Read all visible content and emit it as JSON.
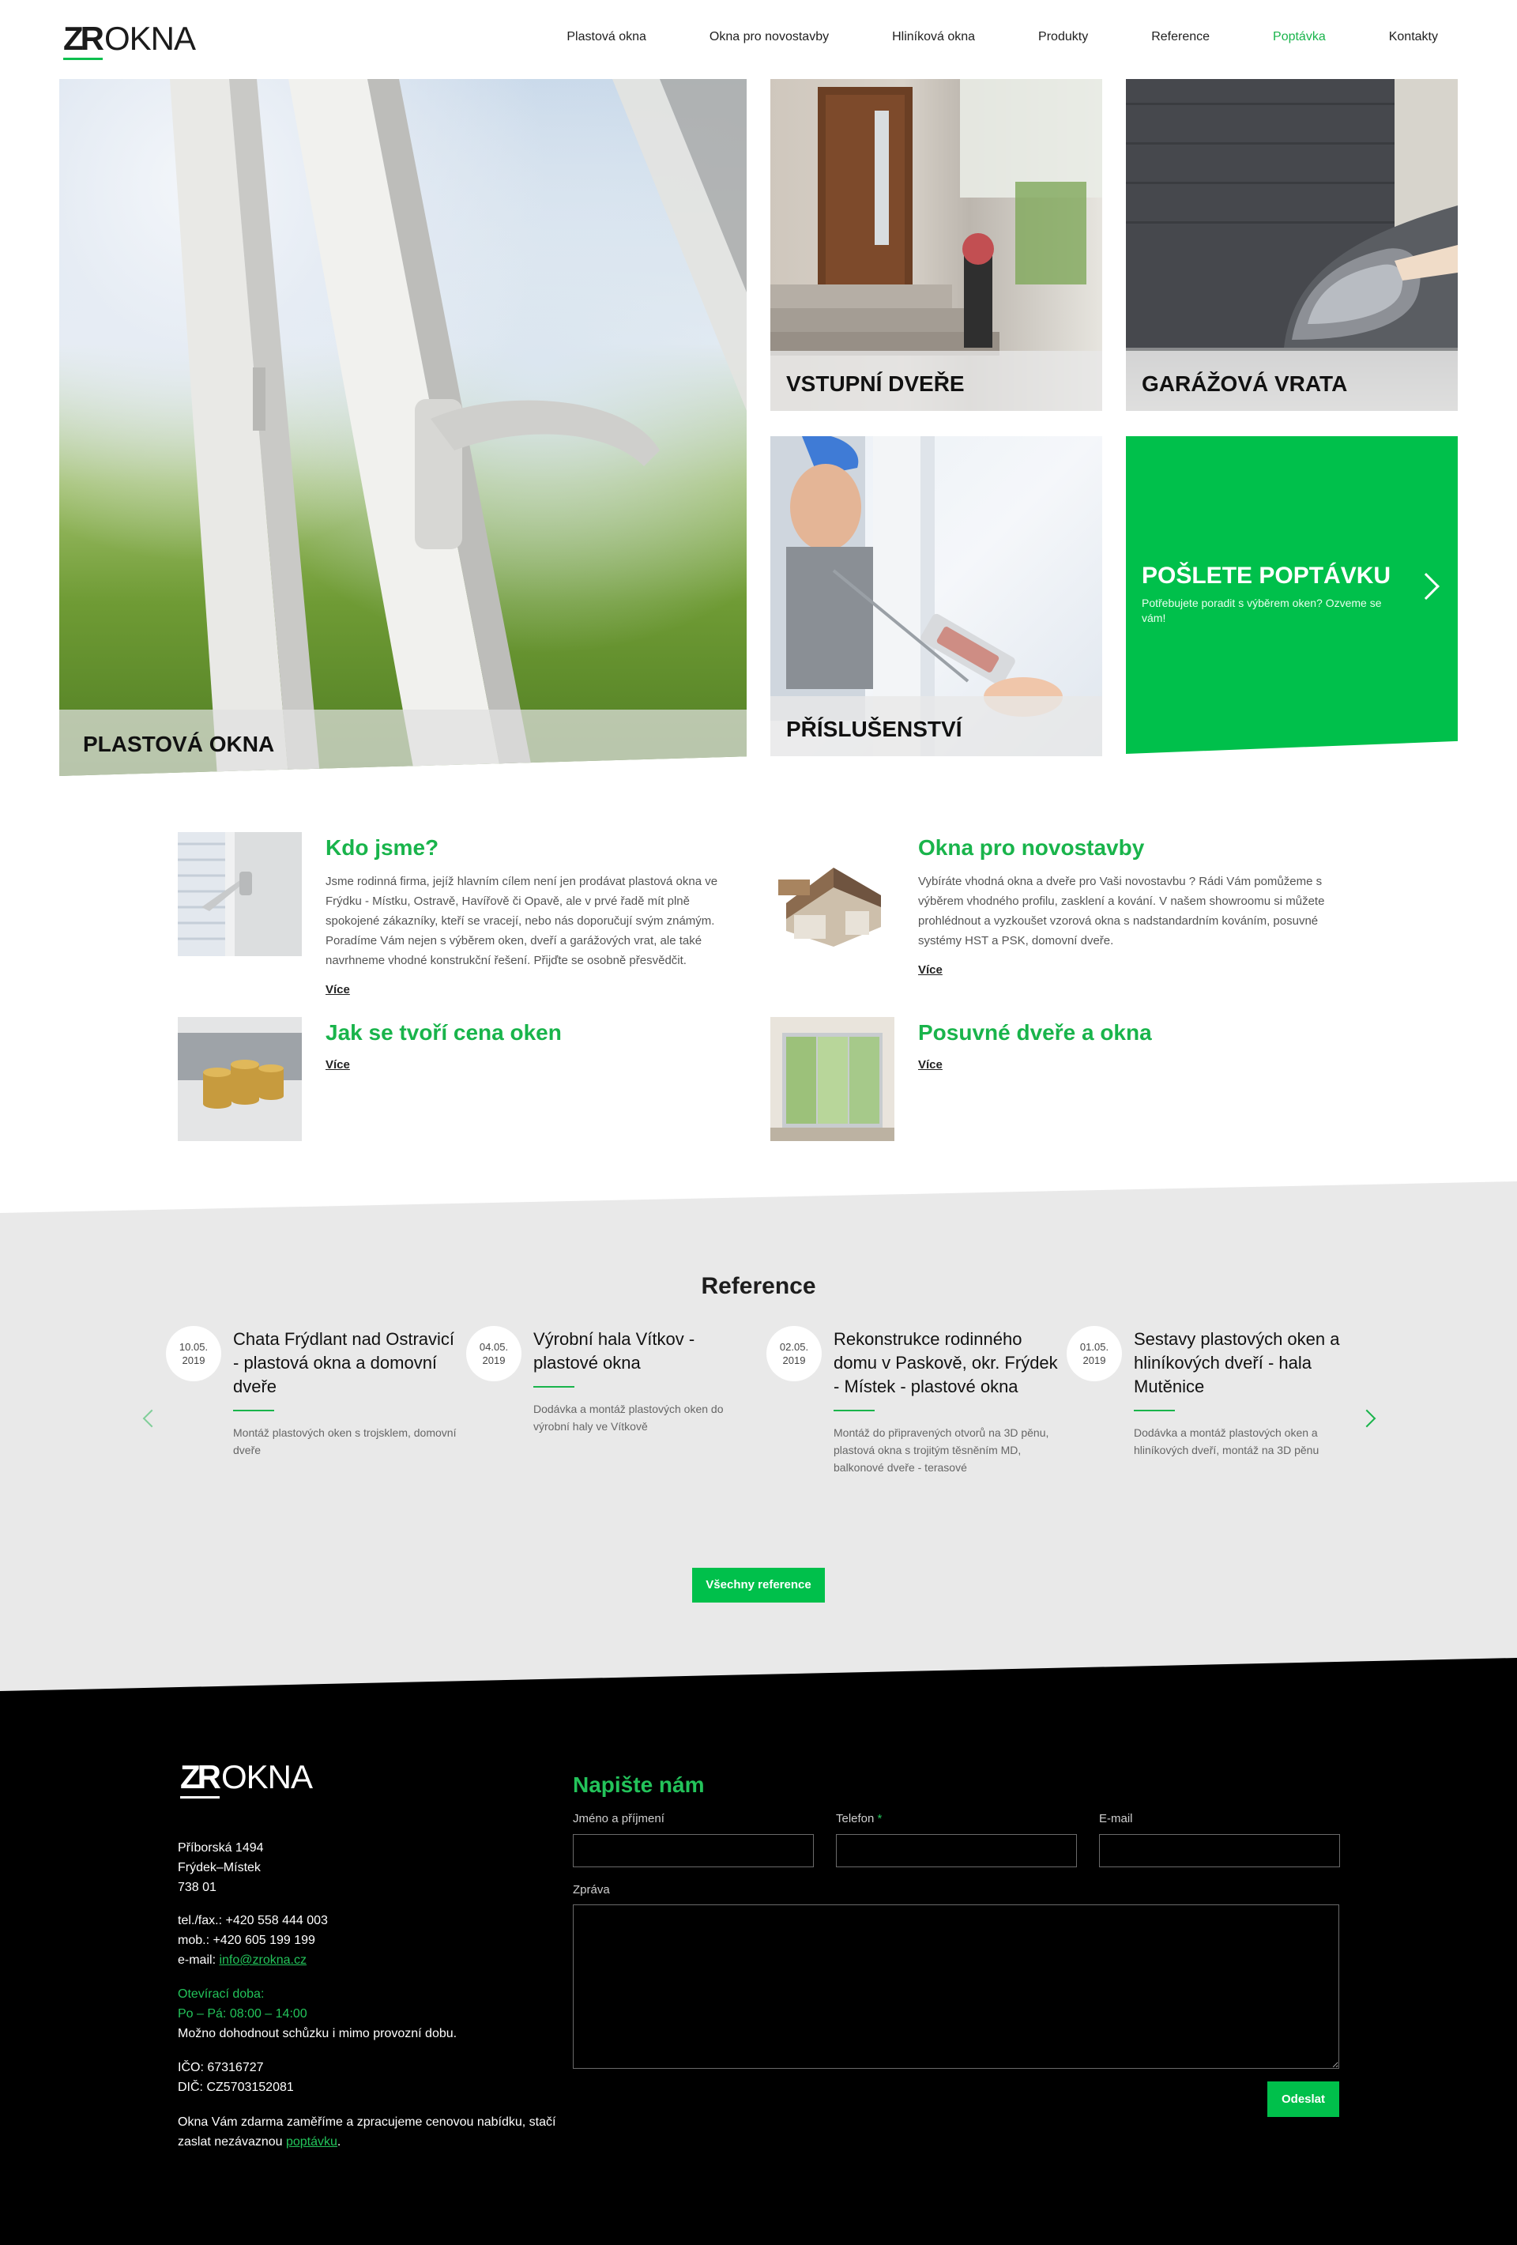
{
  "brand": {
    "logo_mark": "ZR",
    "logo_text": "OKNA"
  },
  "nav": {
    "items": [
      {
        "label": "Plastová okna"
      },
      {
        "label": "Okna pro novostavby"
      },
      {
        "label": "Hliníková okna"
      },
      {
        "label": "Produkty"
      },
      {
        "label": "Reference"
      },
      {
        "label": "Poptávka",
        "active": true
      },
      {
        "label": "Kontakty"
      }
    ]
  },
  "tiles": {
    "main": "PLASTOVÁ OKNA",
    "door": "VSTUPNÍ DVEŘE",
    "garage": "GARÁŽOVÁ VRATA",
    "accessories": "PŘÍSLUŠENSTVÍ",
    "cta_title": "POŠLETE POPTÁVKU",
    "cta_text": "Potřebujete poradit s výběrem oken? Ozveme se vám!"
  },
  "info": {
    "who": {
      "title": "Kdo jsme?",
      "text": "Jsme rodinná firma, jejíž hlavním cílem není jen prodávat plastová okna ve Frýdku - Místku, Ostravě, Havířově či Opavě, ale v prvé řadě mít plně spokojené zákazníky, kteří se vracejí, nebo nás doporučují svým známým. Poradíme Vám nejen s výběrem oken, dveří a garážových vrat, ale také navrhneme vhodné konstrukční řešení. Přijďte se osobně přesvědčit.",
      "more": "Více"
    },
    "new": {
      "title": "Okna pro novostavby",
      "text": "Vybíráte vhodná okna a dveře pro Vaši novostavbu ? Rádi Vám pomůžeme s výběrem vhodného profilu, zasklení a kování. V našem showroomu si můžete prohlédnout a vyzkoušet vzorová okna s nadstandardním kováním, posuvné systémy HST a PSK, domovní dveře.",
      "more": "Více"
    },
    "price": {
      "title": "Jak se tvoří cena oken",
      "more": "Více"
    },
    "sliding": {
      "title": "Posuvné dveře a okna",
      "more": "Více"
    }
  },
  "reference": {
    "title": "Reference",
    "items": [
      {
        "date_day": "10.05.",
        "date_year": "2019",
        "title": "Chata Frýdlant nad Ostravicí - plastová okna a domovní dveře",
        "desc": "Montáž plastových oken s trojsklem, domovní dveře"
      },
      {
        "date_day": "04.05.",
        "date_year": "2019",
        "title": "Výrobní hala Vítkov - plastové okna",
        "desc": "Dodávka a montáž plastových oken do výrobní haly ve Vítkově"
      },
      {
        "date_day": "02.05.",
        "date_year": "2019",
        "title": "Rekonstrukce rodinného domu v Paskově, okr. Frýdek - Místek - plastové okna",
        "desc": "Montáž do připravených otvorů na 3D pěnu, plastová okna s trojitým těsněním MD, balkonové dveře - terasové"
      },
      {
        "date_day": "01.05.",
        "date_year": "2019",
        "title": "Sestavy plastových oken a hliníkových dveří - hala Mutěnice",
        "desc": "Dodávka a montáž plastových oken a hliníkových dveří, montáž na 3D pěnu"
      }
    ],
    "all_button": "Všechny reference"
  },
  "footer": {
    "address": [
      "Příborská 1494",
      "Frýdek–Místek",
      "738 01"
    ],
    "phone": "tel./fax.: +420 558 444 003",
    "mobile": "mob.: +420 605 199 199",
    "email_label": "e-mail: ",
    "email": "info@zrokna.cz",
    "hours_title": "Otevírací doba:",
    "hours": "Po – Pá: 08:00 – 14:00",
    "hours_note": "Možno dohodnout schůzku i mimo provozní dobu.",
    "ico": "IČO: 67316727",
    "dic": "DIČ: CZ5703152081",
    "offer_text": "Okna Vám zdarma zaměříme a zpracujeme cenovou nabídku, stačí zaslat nezávaznou ",
    "offer_link": "poptávku",
    "offer_end": "."
  },
  "form": {
    "title": "Napište nám",
    "name_label": "Jméno a příjmení",
    "phone_label": "Telefon",
    "required_mark": "*",
    "email_label": "E-mail",
    "message_label": "Zpráva",
    "submit": "Odeslat"
  },
  "colors": {
    "accent": "#00c04b",
    "footer_bg": "#000000",
    "ref_bg": "#e9e9e9"
  }
}
